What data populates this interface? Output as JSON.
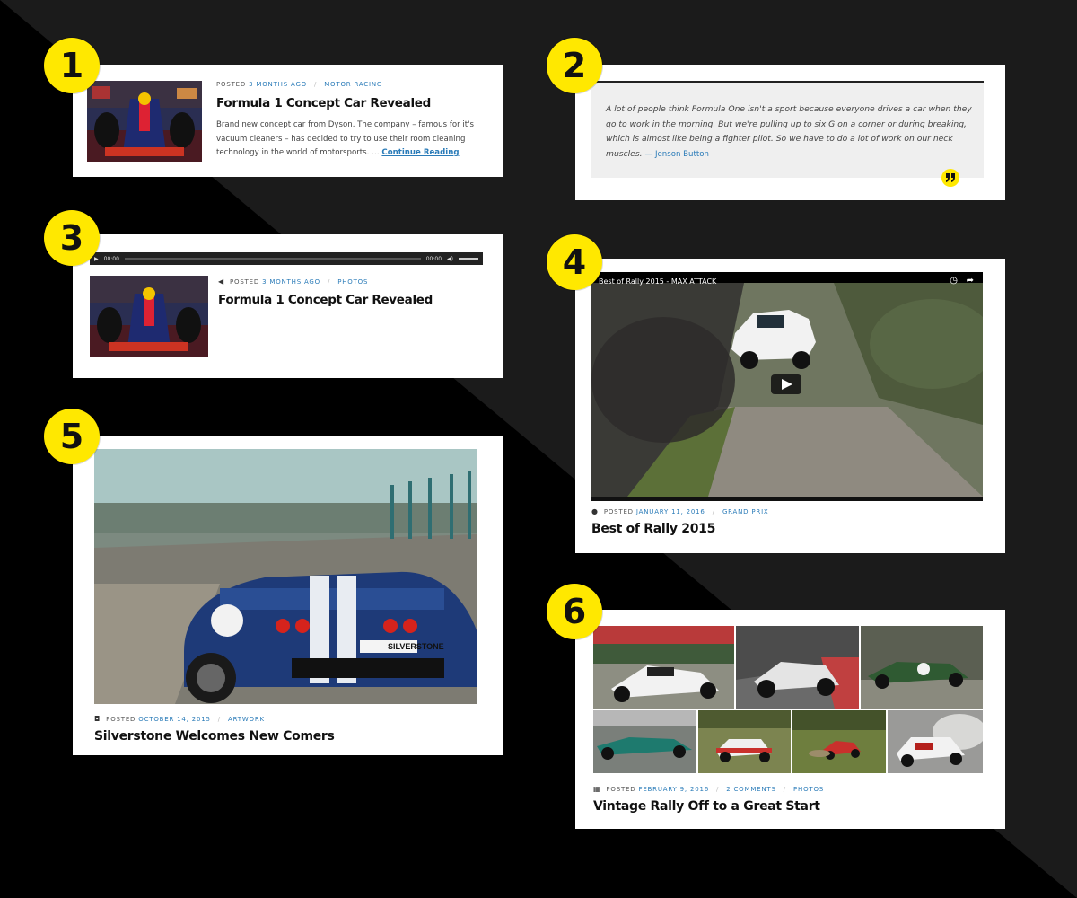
{
  "cards": [
    {
      "badge": "1",
      "meta": {
        "posted": "POSTED",
        "date": "3 MONTHS AGO",
        "category": "MOTOR RACING"
      },
      "title": "Formula 1 Concept Car Revealed",
      "excerpt": "Brand new concept car from Dyson. The company – famous for it's vacuum cleaners – has decided to try to use their room cleaning technology in the world of motorsports. …",
      "read_more": "Continue Reading"
    },
    {
      "badge": "2",
      "quote": "A lot of people think Formula One isn't a sport because everyone drives a car when they go to work in the morning. But we're pulling up to six G on a corner or during breaking, which is almost like being a fighter pilot. So we have to do a lot of work on our neck muscles.",
      "cite_dash": "—",
      "cite": "Jenson Button",
      "icon": "quote-icon"
    },
    {
      "badge": "3",
      "audio": {
        "current": "00:00",
        "duration": "00:00"
      },
      "meta": {
        "posted": "POSTED",
        "date": "3 MONTHS AGO",
        "category": "PHOTOS"
      },
      "title": "Formula 1 Concept Car Revealed"
    },
    {
      "badge": "4",
      "video_title": "Best of Rally 2015 - MAX ATTACK",
      "meta": {
        "posted": "POSTED",
        "date": "JANUARY 11, 2016",
        "category": "GRAND PRIX"
      },
      "title": "Best of Rally 2015"
    },
    {
      "badge": "5",
      "meta": {
        "posted": "POSTED",
        "date": "OCTOBER 14, 2015",
        "category": "ARTWORK"
      },
      "title": "Silverstone Welcomes New Comers",
      "plate": "SILVERSTONE"
    },
    {
      "badge": "6",
      "meta": {
        "posted": "POSTED",
        "date": "FEBRUARY 9, 2016",
        "comments": "2 COMMENTS",
        "category": "PHOTOS"
      },
      "title": "Vintage Rally Off to a Great Start"
    }
  ],
  "colors": {
    "accent": "#ffe800",
    "link": "#2a7bb8",
    "bg_dark": "#1a1a1a",
    "bg_black": "#000000"
  }
}
